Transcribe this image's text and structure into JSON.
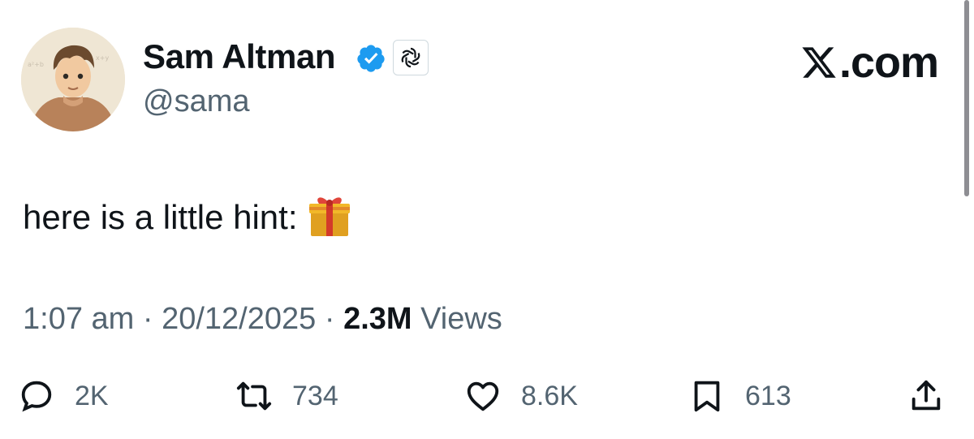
{
  "profile": {
    "name": "Sam Altman",
    "handle": "@sama",
    "verified_color": "#1d9bf0",
    "affiliate_icon": "openai-logo-icon"
  },
  "site_label": ".com",
  "tweet": {
    "text": "here is a little hint:",
    "emoji": "gift-icon"
  },
  "meta": {
    "time": "1:07 am",
    "sep1": "·",
    "date": "20/12/2025",
    "sep2": "·",
    "views_count": "2.3M",
    "views_label": "Views"
  },
  "actions": {
    "replies": "2K",
    "reposts": "734",
    "likes": "8.6K",
    "bookmarks": "613"
  },
  "colors": {
    "text": "#0f1419",
    "secondary": "#536471",
    "accent": "#1d9bf0"
  }
}
